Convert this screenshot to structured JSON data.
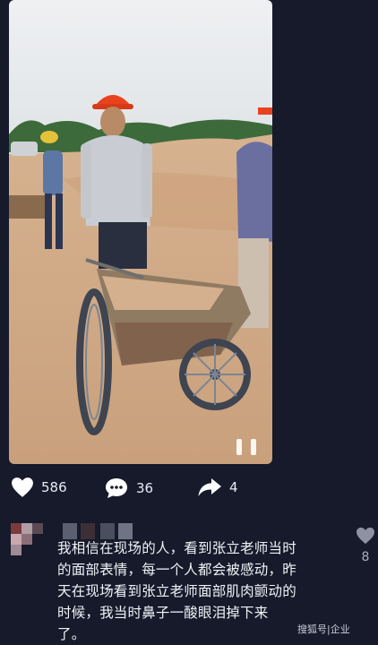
{
  "video": {
    "description_icon": "pause-icon"
  },
  "actions": {
    "likes": "586",
    "comments": "36",
    "shares": "4"
  },
  "comment": {
    "text_lines": [
      "我相信在现场的人，看到张立老师当时",
      "的面部表情，每一个人都会被感动，昨",
      "天在现场看到张立老师面部肌肉颤动的",
      "时候，我当时鼻子一酸眼泪掉下来",
      "了。"
    ],
    "like_count": "8"
  },
  "watermark": "搜狐号|企业",
  "colors": {
    "background": "#161a2b",
    "helmet": "#e8431e",
    "sand": "#d7b493"
  }
}
